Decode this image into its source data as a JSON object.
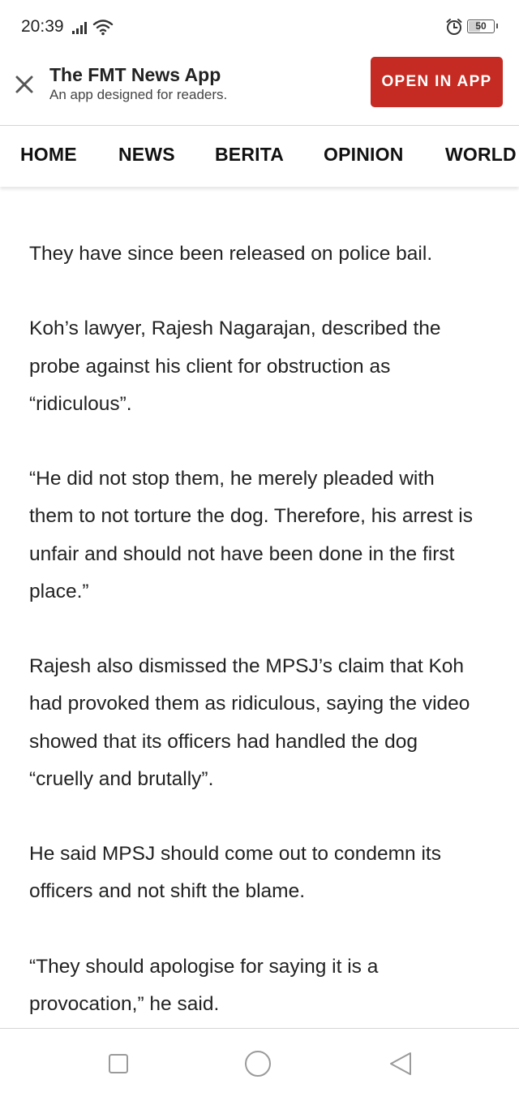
{
  "status_bar": {
    "time": "20:39",
    "battery": "50",
    "battery_level": 0.5,
    "icons": [
      "signal-icon",
      "wifi-icon",
      "alarm-icon",
      "battery-icon"
    ]
  },
  "app_banner": {
    "app_name": "The FMT News App",
    "tagline": "An app designed for readers.",
    "open_button": "OPEN IN APP",
    "accent_color": "#c52b22"
  },
  "nav": {
    "items": [
      "HOME",
      "NEWS",
      "BERITA",
      "OPINION",
      "WORLD"
    ]
  },
  "article": {
    "paragraphs": [
      "They have since been released on police bail.",
      "Koh’s lawyer, Rajesh Nagarajan, described the probe against his client for obstruction as “ridiculous”.",
      "“He did not stop them, he merely pleaded with them to not torture the dog. Therefore, his arrest is unfair and should not have been done in the first place.”",
      "Rajesh also dismissed the MPSJ’s claim that Koh had provoked them as ridiculous, saying the video showed that its officers had handled the dog “cruelly and brutally”.",
      "He said MPSJ should come out to condemn its officers and not shift the blame.",
      "“They should apologise for saying it is a provocation,” he said."
    ]
  },
  "system_nav": {
    "icons": [
      "recents-square-icon",
      "home-circle-icon",
      "back-triangle-icon"
    ]
  }
}
